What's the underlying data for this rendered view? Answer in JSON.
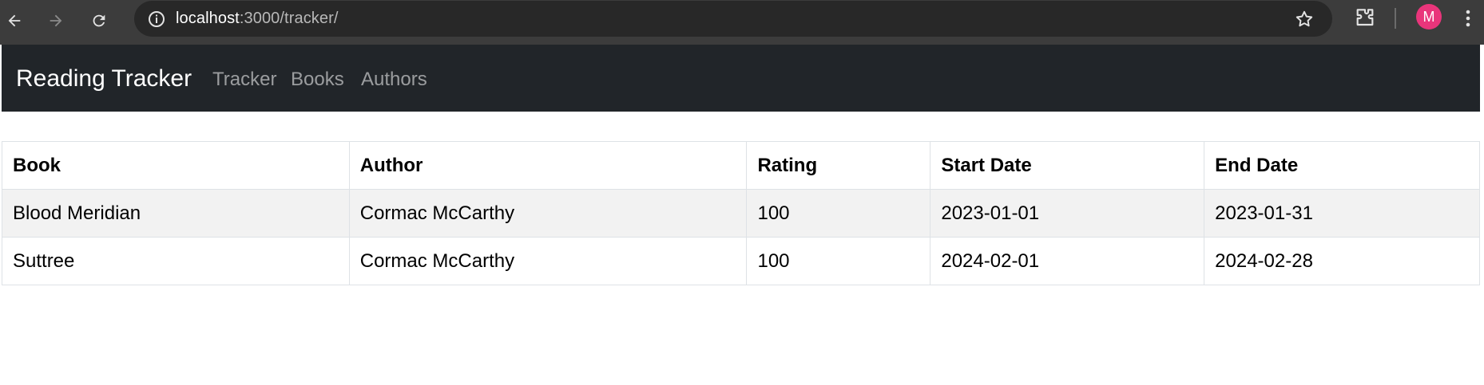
{
  "browser": {
    "url_host": "localhost",
    "url_path": ":3000/tracker/",
    "avatar_initial": "M"
  },
  "navbar": {
    "brand": "Reading Tracker",
    "links": [
      {
        "label": "Tracker"
      },
      {
        "label": "Books"
      },
      {
        "label": "Authors"
      }
    ]
  },
  "table": {
    "headers": [
      "Book",
      "Author",
      "Rating",
      "Start Date",
      "End Date"
    ],
    "rows": [
      [
        "Blood Meridian",
        "Cormac McCarthy",
        "100",
        "2023-01-01",
        "2023-01-31"
      ],
      [
        "Suttree",
        "Cormac McCarthy",
        "100",
        "2024-02-01",
        "2024-02-28"
      ]
    ]
  },
  "icons": {
    "back": "back-arrow-icon",
    "forward": "forward-arrow-icon",
    "reload": "reload-icon",
    "info": "info-icon",
    "bookmark": "star-icon",
    "extensions": "puzzle-icon",
    "menu": "kebab-menu-icon"
  },
  "colors": {
    "navbar_bg": "#212529",
    "chrome_bg": "#3c3c3c",
    "avatar_bg": "#e9357b",
    "stripe": "#f2f2f2"
  }
}
